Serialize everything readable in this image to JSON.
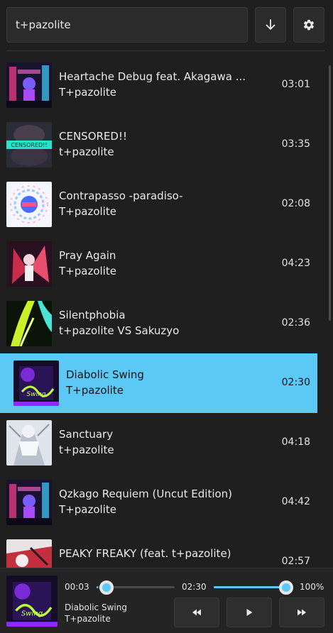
{
  "search": {
    "value": "t+pazolite",
    "placeholder": ""
  },
  "toolbar": {
    "download_icon": "arrow-down-icon",
    "settings_icon": "gear-icon"
  },
  "tracks": [
    {
      "title": "Heartache Debug feat. Akagawa ...",
      "artist": "T+pazolite",
      "duration": "03:01",
      "art": "neon-city"
    },
    {
      "title": "CENSORED!!",
      "artist": "t+pazolite",
      "duration": "03:35",
      "art": "censored",
      "art_text": "CENSORED!!"
    },
    {
      "title": "Contrapasso -paradiso-",
      "artist": "T+pazolite",
      "duration": "02:08",
      "art": "paradiso"
    },
    {
      "title": "Pray Again",
      "artist": "T+pazolite",
      "duration": "04:23",
      "art": "pray"
    },
    {
      "title": "Silentphobia",
      "artist": "t+pazolite VS Sakuzyo",
      "duration": "02:36",
      "art": "silent"
    },
    {
      "title": "Diabolic Swing",
      "artist": "T+pazolite",
      "duration": "02:30",
      "art": "diabolic",
      "active": true
    },
    {
      "title": "Sanctuary",
      "artist": "t+pazolite",
      "duration": "04:18",
      "art": "sanctuary"
    },
    {
      "title": "Qzkago Requiem (Uncut Edition)",
      "artist": "T+pazolite",
      "duration": "04:42",
      "art": "neon-city"
    },
    {
      "title": "PEAKY FREAKY (feat. t+pazolite)",
      "artist": "",
      "duration": "02:57",
      "art": "peaky"
    }
  ],
  "player": {
    "title": "Diabolic Swing",
    "artist": "T+pazolite",
    "current_time": "00:03",
    "total_time": "02:30",
    "progress": 0.02,
    "volume": 1.0,
    "volume_label": "100%",
    "accent": "#5bc8f5"
  }
}
